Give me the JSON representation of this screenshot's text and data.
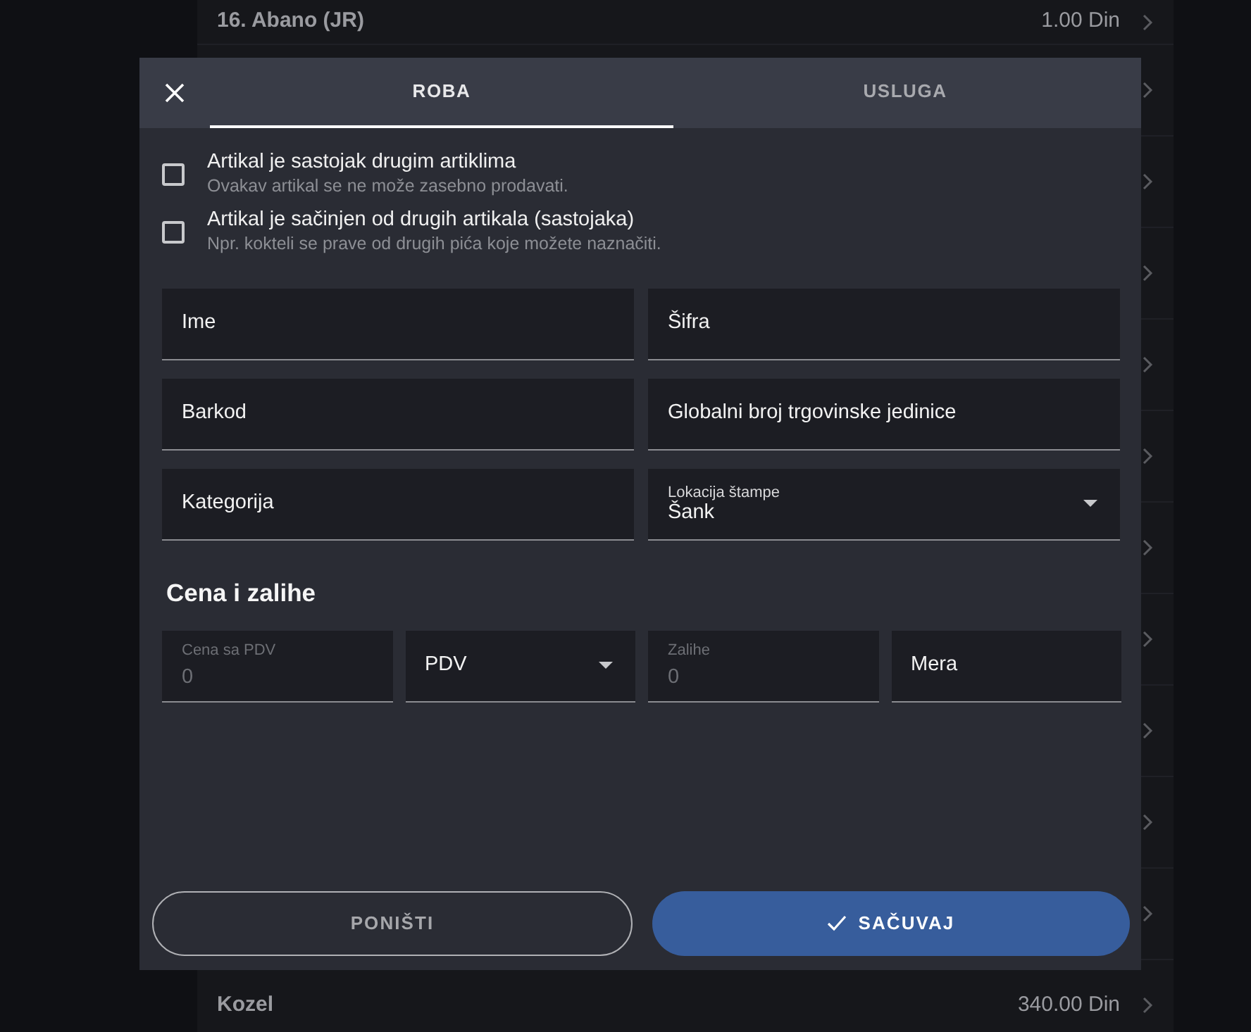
{
  "background_list": {
    "rows": [
      {
        "name": "16. Abano (JR)",
        "price": "1.00 Din"
      },
      {
        "name": "",
        "price": ""
      },
      {
        "name": "",
        "price": ""
      },
      {
        "name": "",
        "price": ""
      },
      {
        "name": "",
        "price": ""
      },
      {
        "name": "",
        "price": ""
      },
      {
        "name": "",
        "price": ""
      },
      {
        "name": "",
        "price": ""
      },
      {
        "name": "",
        "price": ""
      },
      {
        "name": "",
        "price": ""
      },
      {
        "name": "",
        "price": ""
      },
      {
        "name": "Kozel",
        "price": "340.00 Din"
      }
    ]
  },
  "dialog": {
    "tabs": [
      {
        "label": "ROBA",
        "selected": true
      },
      {
        "label": "USLUGA",
        "selected": false
      }
    ],
    "checkboxes": [
      {
        "label": "Artikal je sastojak drugim artiklima",
        "hint": "Ovakav artikal se ne može zasebno prodavati.",
        "checked": false
      },
      {
        "label": "Artikal je sačinjen od drugih artikala (sastojaka)",
        "hint": "Npr. kokteli se prave od drugih pića koje možete naznačiti.",
        "checked": false
      }
    ],
    "fields": [
      {
        "kind": "text",
        "label": "Ime"
      },
      {
        "kind": "text",
        "label": "Šifra"
      },
      {
        "kind": "text",
        "label": "Barkod"
      },
      {
        "kind": "text",
        "label": "Globalni broj trgovinske jedinice"
      },
      {
        "kind": "text",
        "label": "Kategorija"
      },
      {
        "kind": "select",
        "label": "Lokacija štampe",
        "value": "Šank"
      }
    ],
    "section_title": "Cena i zalihe",
    "price_fields": [
      {
        "kind": "number",
        "label": "Cena sa PDV",
        "placeholder": "0"
      },
      {
        "kind": "select",
        "label": "PDV"
      },
      {
        "kind": "number",
        "label": "Zalihe",
        "placeholder": "0"
      },
      {
        "kind": "text",
        "label": "Mera"
      }
    ],
    "buttons": [
      {
        "kind": "outline",
        "label": "PONIŠTI"
      },
      {
        "kind": "primary",
        "label": "SAČUVAJ"
      }
    ]
  }
}
